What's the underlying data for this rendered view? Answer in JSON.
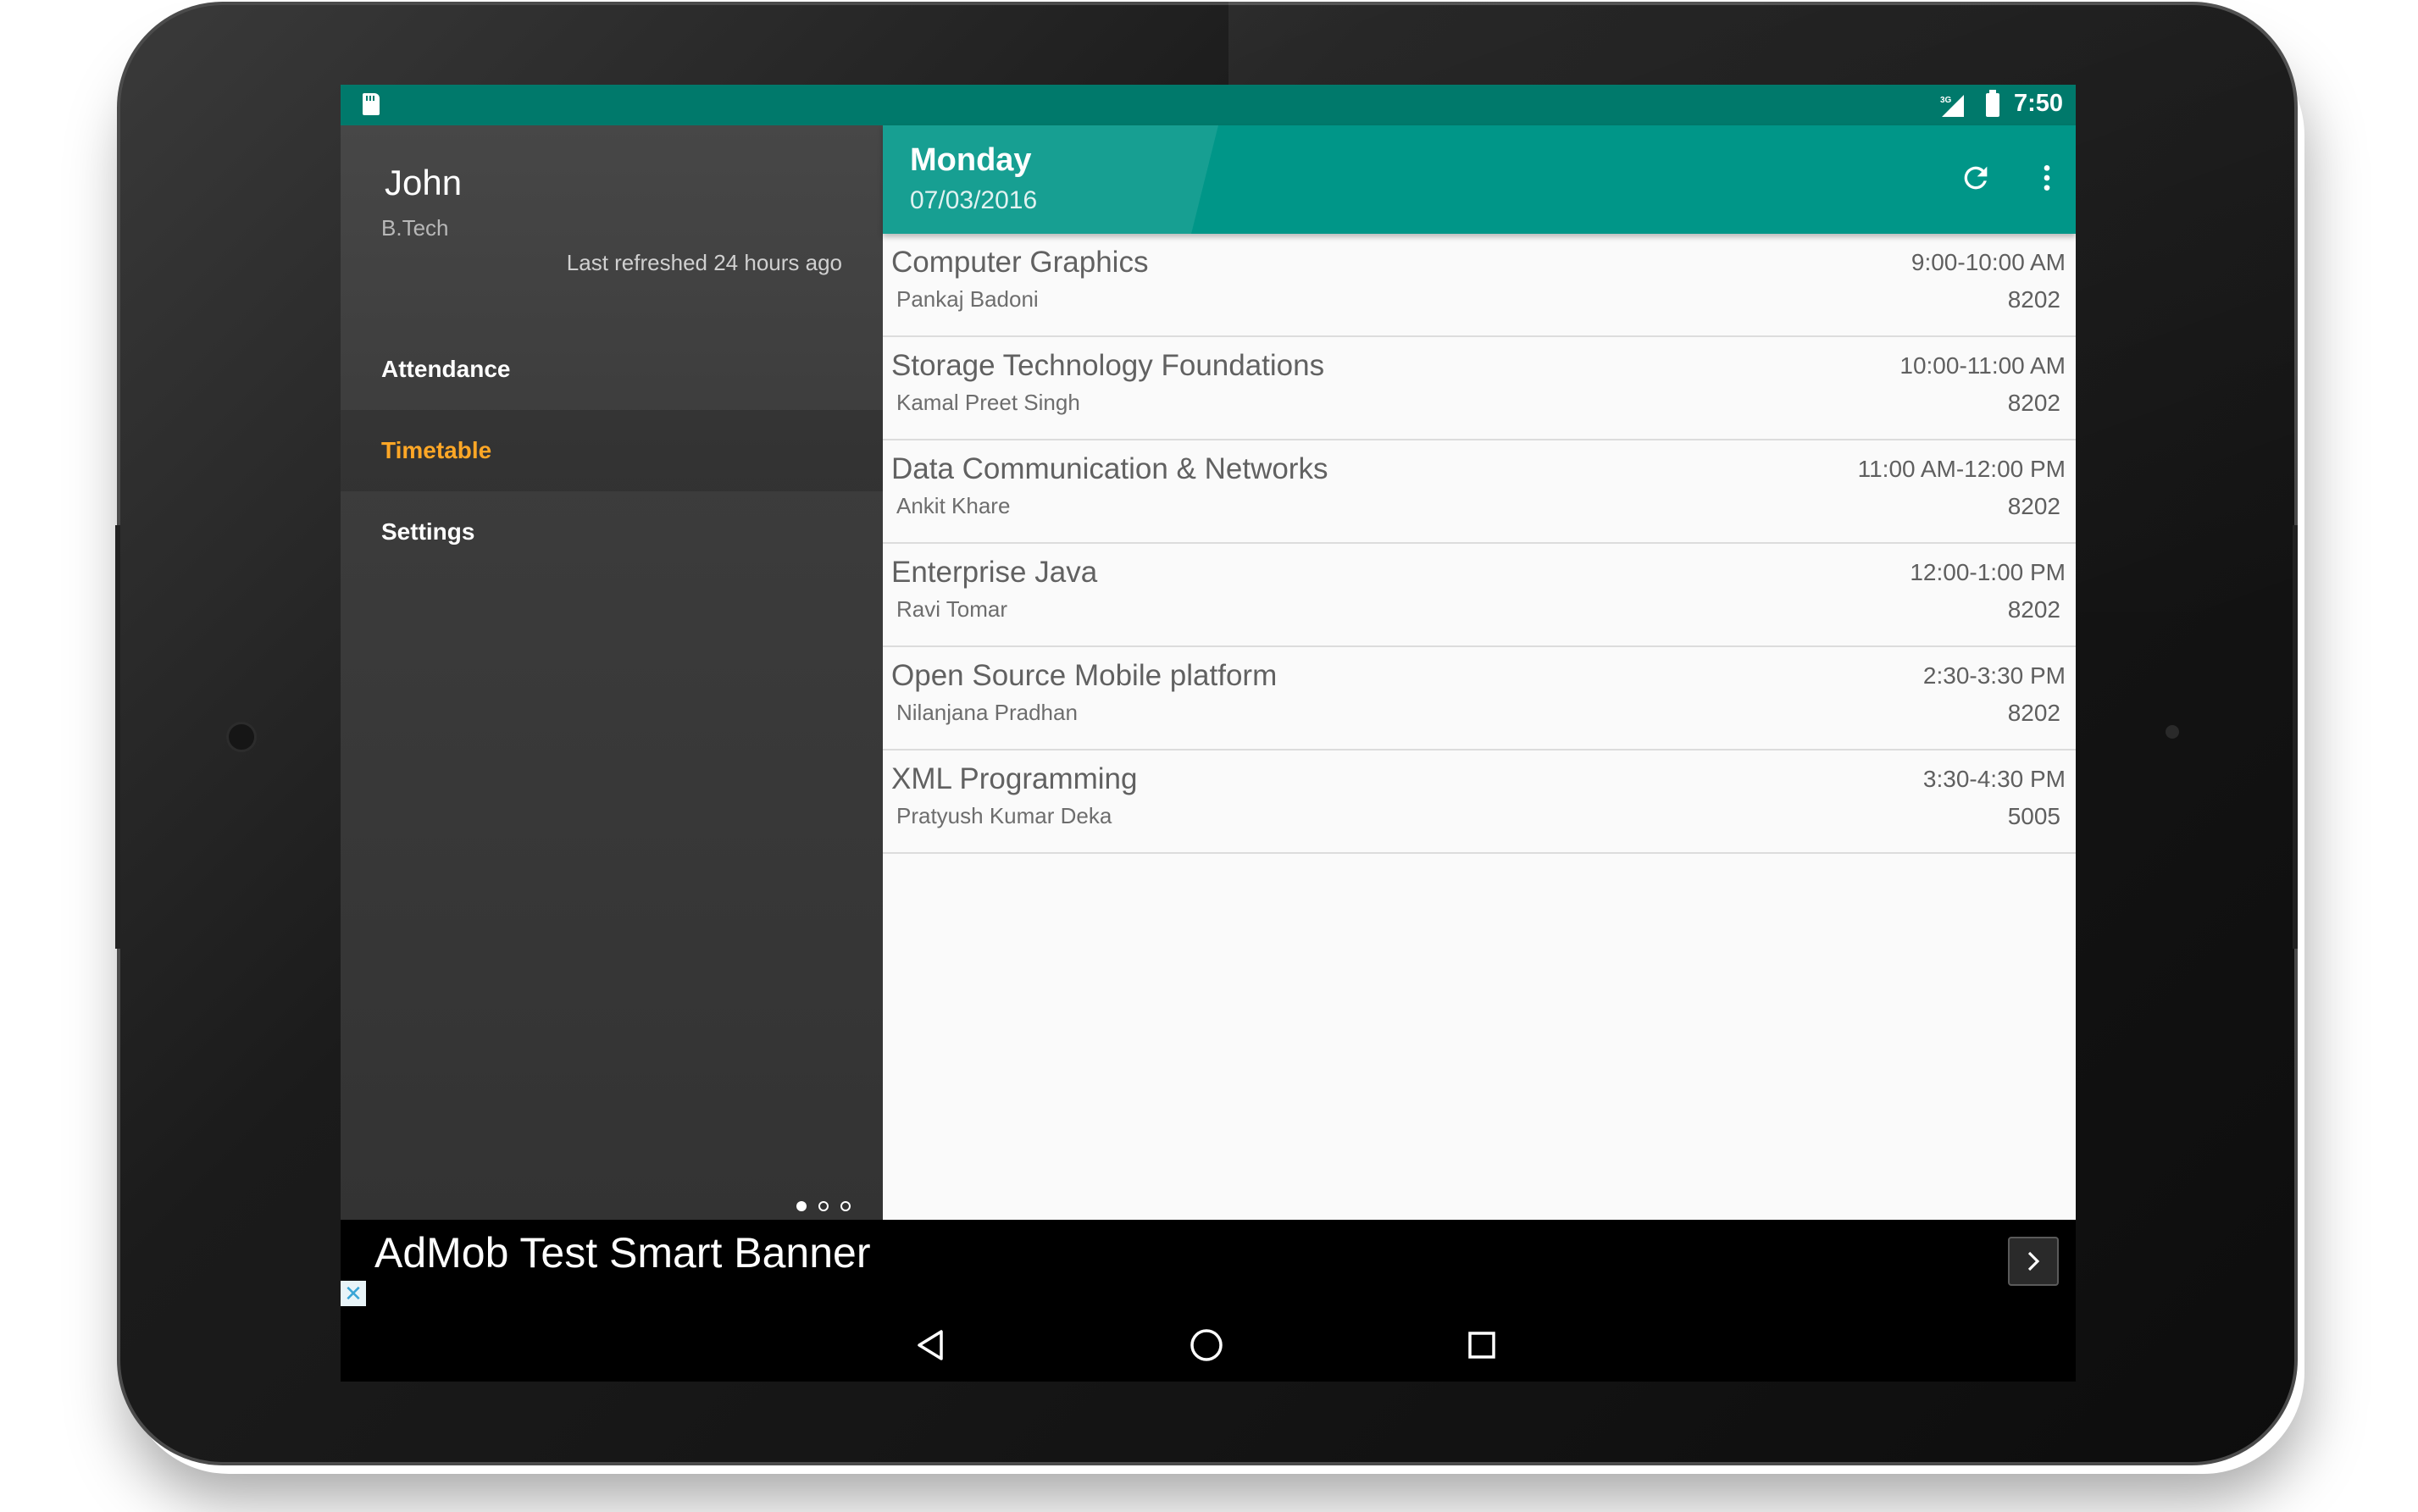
{
  "status_bar": {
    "time": "7:50",
    "network": "3G",
    "icons": [
      "sd-card-icon",
      "signal-icon",
      "battery-icon"
    ]
  },
  "drawer": {
    "user_name": "John",
    "course": "B.Tech",
    "last_refreshed": "Last refreshed 24 hours ago",
    "items": [
      {
        "label": "Attendance",
        "active": false
      },
      {
        "label": "Timetable",
        "active": true
      },
      {
        "label": "Settings",
        "active": false
      }
    ]
  },
  "toolbar": {
    "day": "Monday",
    "date": "07/03/2016",
    "actions": [
      "refresh-icon",
      "more-vert-icon"
    ]
  },
  "timetable": [
    {
      "subject": "Computer Graphics",
      "teacher": "Pankaj Badoni",
      "time": "9:00-10:00 AM",
      "room": "8202"
    },
    {
      "subject": "Storage Technology Foundations",
      "teacher": "Kamal Preet Singh",
      "time": "10:00-11:00 AM",
      "room": "8202"
    },
    {
      "subject": "Data Communication & Networks",
      "teacher": "Ankit Khare",
      "time": "11:00 AM-12:00 PM",
      "room": "8202"
    },
    {
      "subject": "Enterprise Java",
      "teacher": "Ravi Tomar",
      "time": "12:00-1:00 PM",
      "room": "8202"
    },
    {
      "subject": "Open Source Mobile platform",
      "teacher": "Nilanjana Pradhan",
      "time": "2:30-3:30 PM",
      "room": "8202"
    },
    {
      "subject": "XML Programming",
      "teacher": "Pratyush Kumar Deka",
      "time": "3:30-4:30 PM",
      "room": "5005"
    }
  ],
  "ad": {
    "text": "AdMob Test Smart Banner",
    "close_symbol": "✕"
  },
  "pager": {
    "count": 3,
    "active_index": 0
  },
  "colors": {
    "status_bar": "#00796b",
    "app_bar": "#009688",
    "accent": "#ffa726",
    "drawer": "#3c3c3c"
  }
}
